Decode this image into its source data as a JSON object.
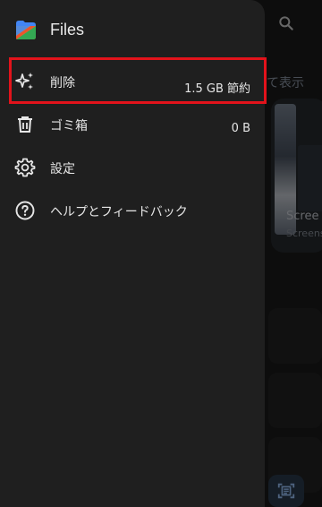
{
  "app": {
    "title": "Files",
    "logo_icon": "files-app-logo"
  },
  "menu": {
    "items": [
      {
        "label": "削除",
        "value": "1.5 GB 節約",
        "icon": "sparkle-icon"
      },
      {
        "label": "ゴミ箱",
        "value": "0 B",
        "icon": "trash-icon"
      },
      {
        "label": "設定",
        "value": "",
        "icon": "gear-icon"
      },
      {
        "label": "ヘルプとフィードバック",
        "value": "",
        "icon": "help-icon"
      }
    ]
  },
  "background": {
    "show_label": "て表示",
    "card_title": "Scree",
    "card_subtitle": "Screens"
  },
  "colors": {
    "drawer_bg": "#1f1f1f",
    "highlight": "#e2131b",
    "text": "#e6e6e6"
  }
}
